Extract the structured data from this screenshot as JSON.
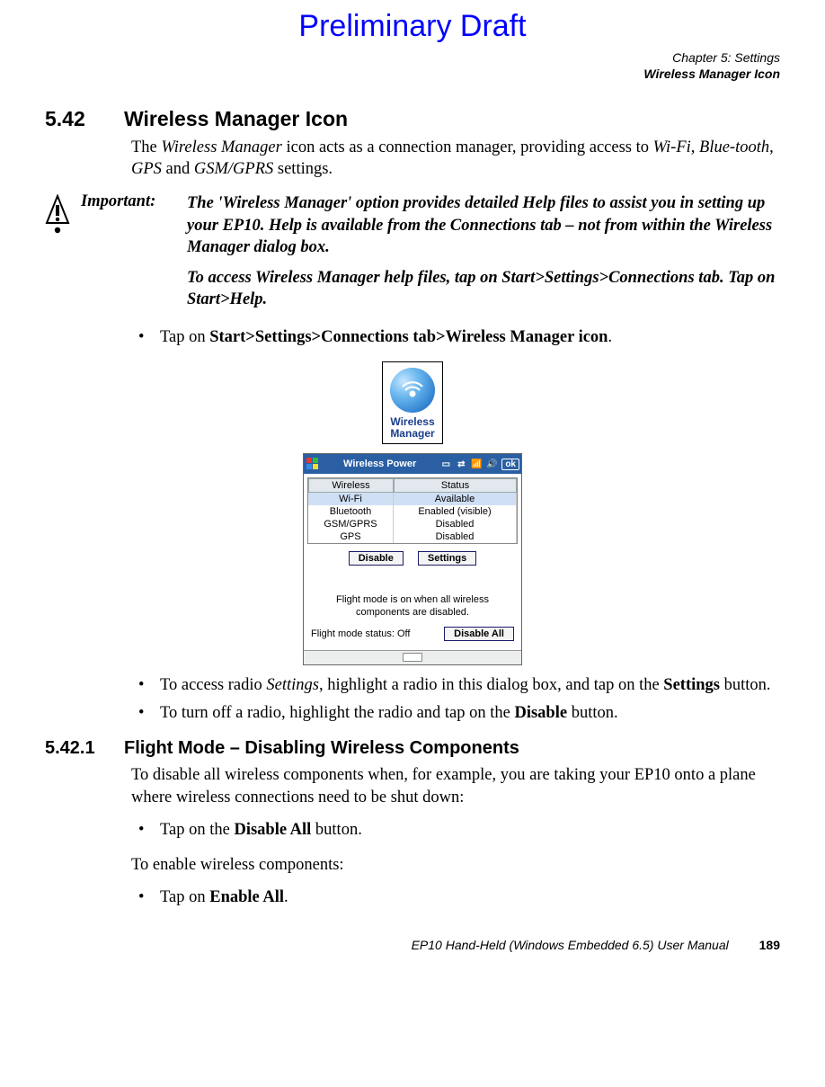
{
  "draft": "Preliminary Draft",
  "chapter": {
    "line1": "Chapter 5: Settings",
    "line2": "Wireless Manager Icon"
  },
  "s542": {
    "num": "5.42",
    "title": "Wireless Manager Icon",
    "intro_a": "The ",
    "intro_b": "Wireless Manager",
    "intro_c": " icon acts as a connection manager, providing access to ",
    "intro_d": "Wi-Fi",
    "intro_e": ", ",
    "intro_f": "Blue-tooth",
    "intro_g": ", ",
    "intro_h": "GPS",
    "intro_i": " and ",
    "intro_j": "GSM/GPRS",
    "intro_k": " settings."
  },
  "important": {
    "label": "Important:",
    "p1": "The 'Wireless Manager' option provides detailed Help files to assist you in setting up your EP10. Help is available from the Connections tab – not from within the Wireless Manager dialog box.",
    "p2": "To access Wireless Manager help files, tap on Start>Settings>Connections tab. Tap on Start>Help."
  },
  "bullets1": {
    "b1_a": "Tap on ",
    "b1_b": "Start>Settings>Connections tab>Wireless Manager icon",
    "b1_c": "."
  },
  "icon_caption": {
    "l1": "Wireless",
    "l2": "Manager"
  },
  "device": {
    "title": "Wireless Power",
    "ok": "ok",
    "col_wireless": "Wireless",
    "col_status": "Status",
    "rows": [
      {
        "w": "Wi-Fi",
        "s": "Available"
      },
      {
        "w": "Bluetooth",
        "s": "Enabled (visible)"
      },
      {
        "w": "GSM/GPRS",
        "s": "Disabled"
      },
      {
        "w": "GPS",
        "s": "Disabled"
      }
    ],
    "btn_disable": "Disable",
    "btn_settings": "Settings",
    "note": "Flight mode is on when all wireless components are disabled.",
    "status_label": "Flight mode status: Off",
    "btn_disable_all": "Disable All"
  },
  "bullets2": {
    "b1_a": "To access radio ",
    "b1_b": "Settings",
    "b1_c": ", highlight a radio in this dialog box, and tap on the ",
    "b1_d": "Settings",
    "b1_e": " button.",
    "b2_a": "To turn off a radio, highlight the radio and tap on the ",
    "b2_b": "Disable",
    "b2_c": " button."
  },
  "s5421": {
    "num": "5.42.1",
    "title": "Flight Mode – Disabling Wireless Components",
    "p1": "To disable all wireless components when, for example, you are taking your EP10 onto a plane where wireless connections need to be shut down:",
    "b1_a": "Tap on the ",
    "b1_b": "Disable All",
    "b1_c": " button.",
    "p2": "To enable wireless components:",
    "b2_a": "Tap on ",
    "b2_b": "Enable All",
    "b2_c": "."
  },
  "footer": {
    "text": "EP10 Hand-Held (Windows Embedded 6.5) User Manual",
    "page": "189"
  }
}
